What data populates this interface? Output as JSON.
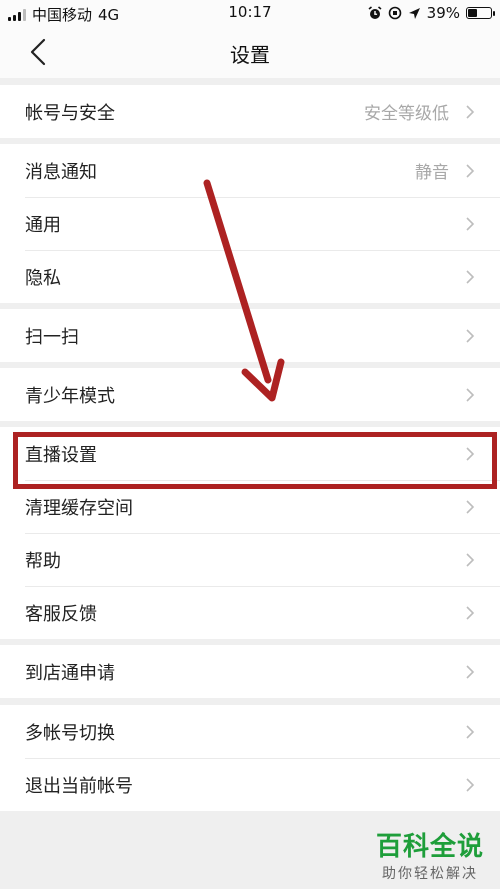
{
  "status_bar": {
    "carrier": "中国移动",
    "network": "4G",
    "time": "10:17",
    "battery": "39%",
    "battery_level": 0.39
  },
  "nav": {
    "title": "设置"
  },
  "groups": [
    {
      "rows": [
        {
          "label": "帐号与安全",
          "value": "安全等级低"
        }
      ]
    },
    {
      "rows": [
        {
          "label": "消息通知",
          "value": "静音"
        },
        {
          "label": "通用",
          "value": ""
        },
        {
          "label": "隐私",
          "value": ""
        }
      ]
    },
    {
      "rows": [
        {
          "label": "扫一扫",
          "value": ""
        }
      ]
    },
    {
      "rows": [
        {
          "label": "青少年模式",
          "value": ""
        }
      ]
    },
    {
      "rows": [
        {
          "label": "直播设置",
          "value": ""
        },
        {
          "label": "清理缓存空间",
          "value": ""
        },
        {
          "label": "帮助",
          "value": ""
        },
        {
          "label": "客服反馈",
          "value": ""
        }
      ]
    },
    {
      "rows": [
        {
          "label": "到店通申请",
          "value": ""
        }
      ]
    },
    {
      "rows": [
        {
          "label": "多帐号切换",
          "value": ""
        },
        {
          "label": "退出当前帐号",
          "value": ""
        }
      ]
    }
  ],
  "annotation": {
    "color": "#ad2222",
    "highlighted_item": "直播设置"
  },
  "watermark": {
    "title": "百科全说",
    "subtitle": "助你轻松解决",
    "color": "#1e9e3a"
  }
}
